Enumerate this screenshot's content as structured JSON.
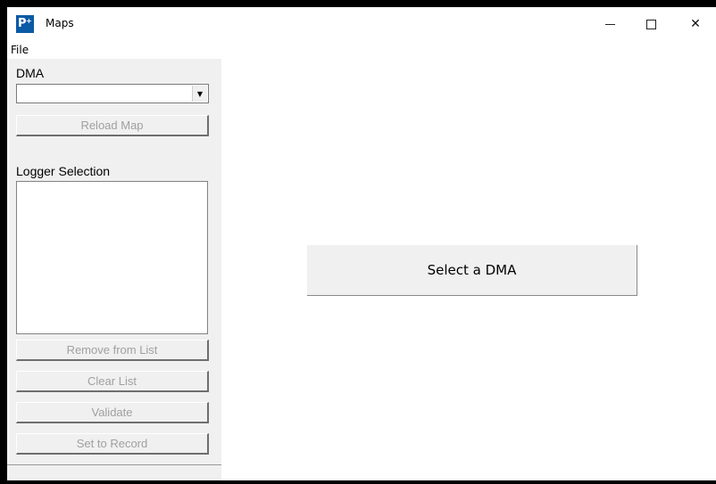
{
  "window": {
    "title": "Maps",
    "app_icon_text": "P",
    "app_icon_sup": "+",
    "controls": {
      "minimize": "minimize",
      "maximize": "maximize",
      "close": "✕"
    }
  },
  "menu": {
    "file": "File"
  },
  "left_panel": {
    "dma_label": "DMA",
    "dma_value": "",
    "dma_dropdown_arrow": "▼",
    "reload_map": "Reload Map",
    "logger_selection_label": "Logger Selection",
    "logger_items": [],
    "remove_from_list": "Remove from List",
    "clear_list": "Clear List",
    "validate": "Validate",
    "set_to_record": "Set to Record"
  },
  "main": {
    "select_dma": "Select a DMA"
  },
  "colors": {
    "panel_bg": "#f0f0f0",
    "disabled_text": "#a0a0a0",
    "app_icon_bg": "#0a5aa6"
  }
}
